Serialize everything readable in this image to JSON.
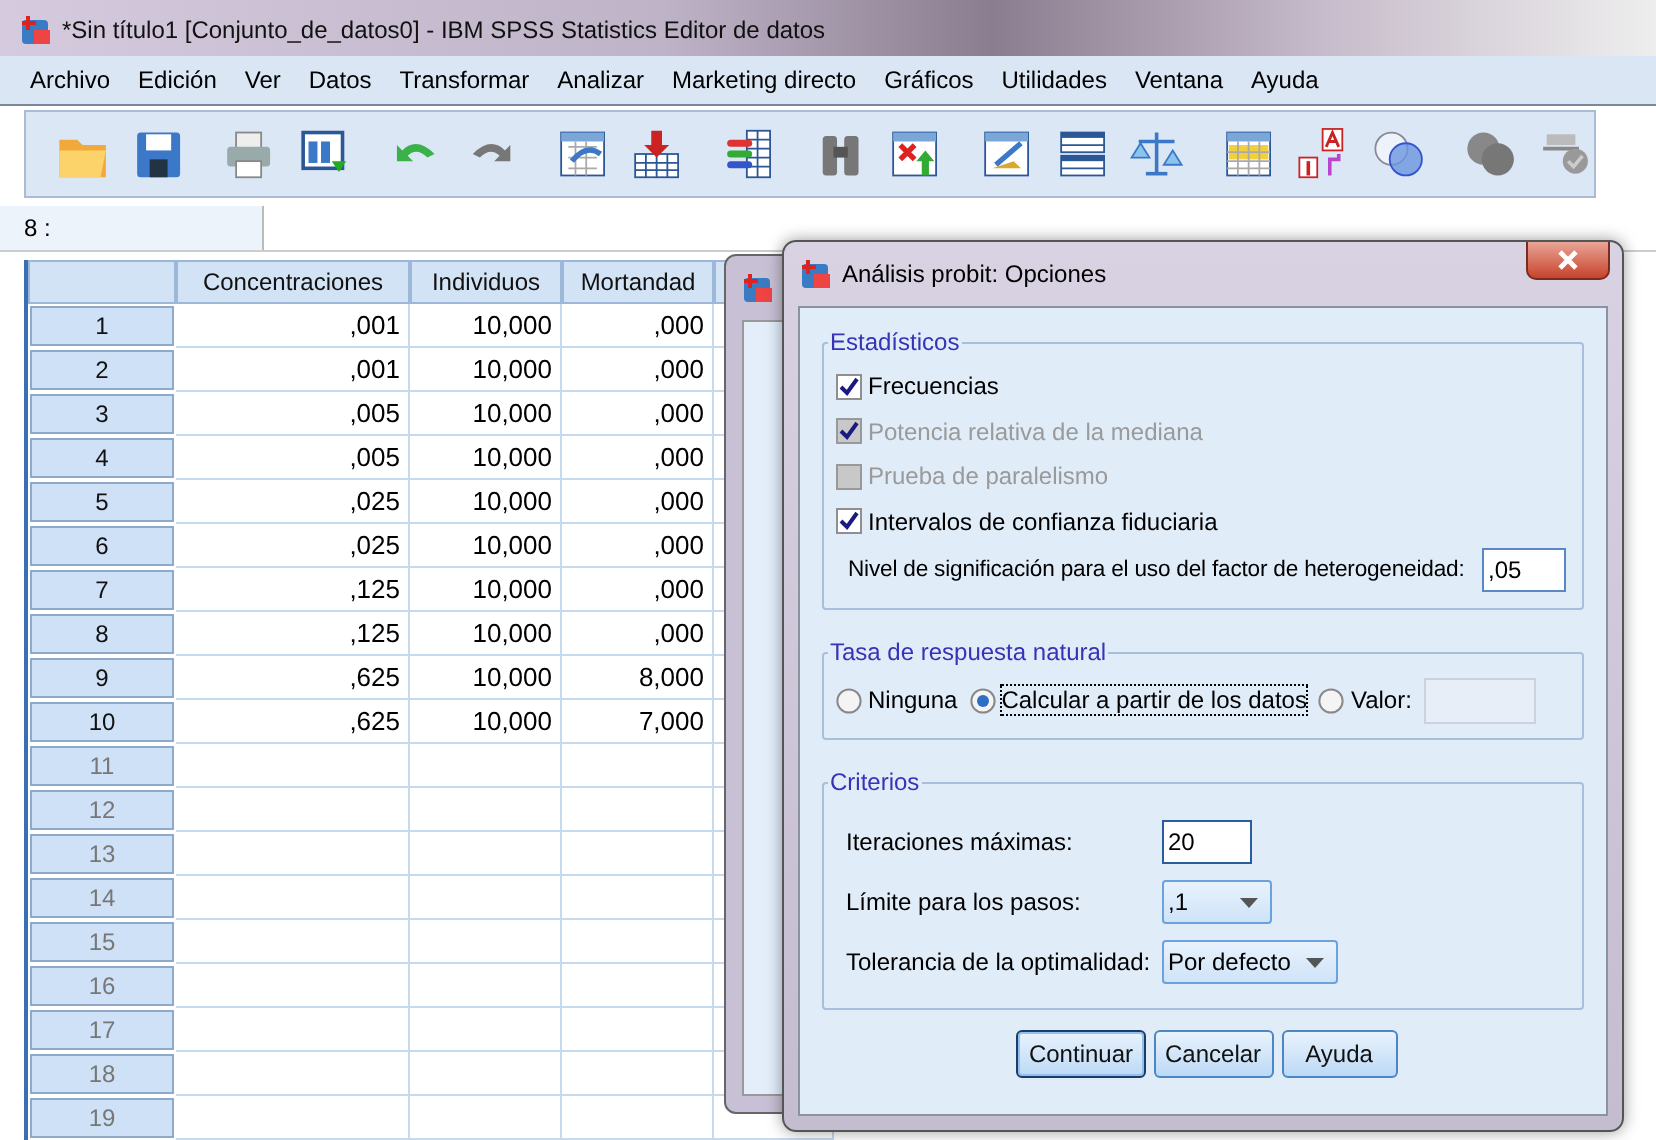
{
  "window": {
    "title": "*Sin título1 [Conjunto_de_datos0] - IBM SPSS Statistics Editor de datos"
  },
  "menu": [
    "Archivo",
    "Edición",
    "Ver",
    "Datos",
    "Transformar",
    "Analizar",
    "Marketing directo",
    "Gráficos",
    "Utilidades",
    "Ventana",
    "Ayuda"
  ],
  "cell_editor": {
    "label": "8 :"
  },
  "table": {
    "columns": [
      "Concentraciones",
      "Individuos",
      "Mortandad"
    ],
    "rows": [
      {
        "number": "1",
        "cells": [
          ",001",
          "10,000",
          ",000"
        ]
      },
      {
        "number": "2",
        "cells": [
          ",001",
          "10,000",
          ",000"
        ]
      },
      {
        "number": "3",
        "cells": [
          ",005",
          "10,000",
          ",000"
        ]
      },
      {
        "number": "4",
        "cells": [
          ",005",
          "10,000",
          ",000"
        ]
      },
      {
        "number": "5",
        "cells": [
          ",025",
          "10,000",
          ",000"
        ]
      },
      {
        "number": "6",
        "cells": [
          ",025",
          "10,000",
          ",000"
        ]
      },
      {
        "number": "7",
        "cells": [
          ",125",
          "10,000",
          ",000"
        ]
      },
      {
        "number": "8",
        "cells": [
          ",125",
          "10,000",
          ",000"
        ]
      },
      {
        "number": "9",
        "cells": [
          ",625",
          "10,000",
          "8,000"
        ]
      },
      {
        "number": "10",
        "cells": [
          ",625",
          "10,000",
          "7,000"
        ]
      },
      {
        "number": "11"
      },
      {
        "number": "12"
      },
      {
        "number": "13"
      },
      {
        "number": "14"
      },
      {
        "number": "15"
      },
      {
        "number": "16"
      },
      {
        "number": "17"
      },
      {
        "number": "18"
      },
      {
        "number": "19"
      }
    ]
  },
  "dialog": {
    "title": "Análisis probit: Opciones",
    "statistics": {
      "legend": "Estadísticos",
      "options": [
        {
          "label": "Frecuencias",
          "checked": true,
          "disabled": false
        },
        {
          "label": "Potencia relativa de la mediana",
          "checked": true,
          "disabled": true
        },
        {
          "label": "Prueba de paralelismo",
          "checked": false,
          "disabled": true
        },
        {
          "label": "Intervalos de confianza fiduciaria",
          "checked": true,
          "disabled": false
        }
      ],
      "significance": {
        "label": "Nivel de significación para el uso del factor de heterogeneidad:",
        "value": ",05"
      }
    },
    "natural_response": {
      "legend": "Tasa de respuesta natural",
      "options": [
        {
          "label": "Ninguna",
          "selected": false,
          "focused": false
        },
        {
          "label": "Calcular a partir de los datos",
          "selected": true,
          "focused": true
        },
        {
          "label": "Valor:",
          "selected": false,
          "focused": false
        }
      ]
    },
    "criteria": {
      "legend": "Criterios",
      "fields": [
        {
          "kind": "input",
          "label": "Iteraciones máximas:",
          "value": "20"
        },
        {
          "kind": "dropdown",
          "label": "Límite para los pasos:",
          "value": ",1"
        },
        {
          "kind": "dropdown",
          "label": "Tolerancia de la optimalidad:",
          "value": "Por defecto"
        }
      ]
    },
    "buttons": [
      {
        "label": "Continuar",
        "default": true
      },
      {
        "label": "Cancelar",
        "default": false
      },
      {
        "label": "Ayuda",
        "default": false
      }
    ]
  }
}
